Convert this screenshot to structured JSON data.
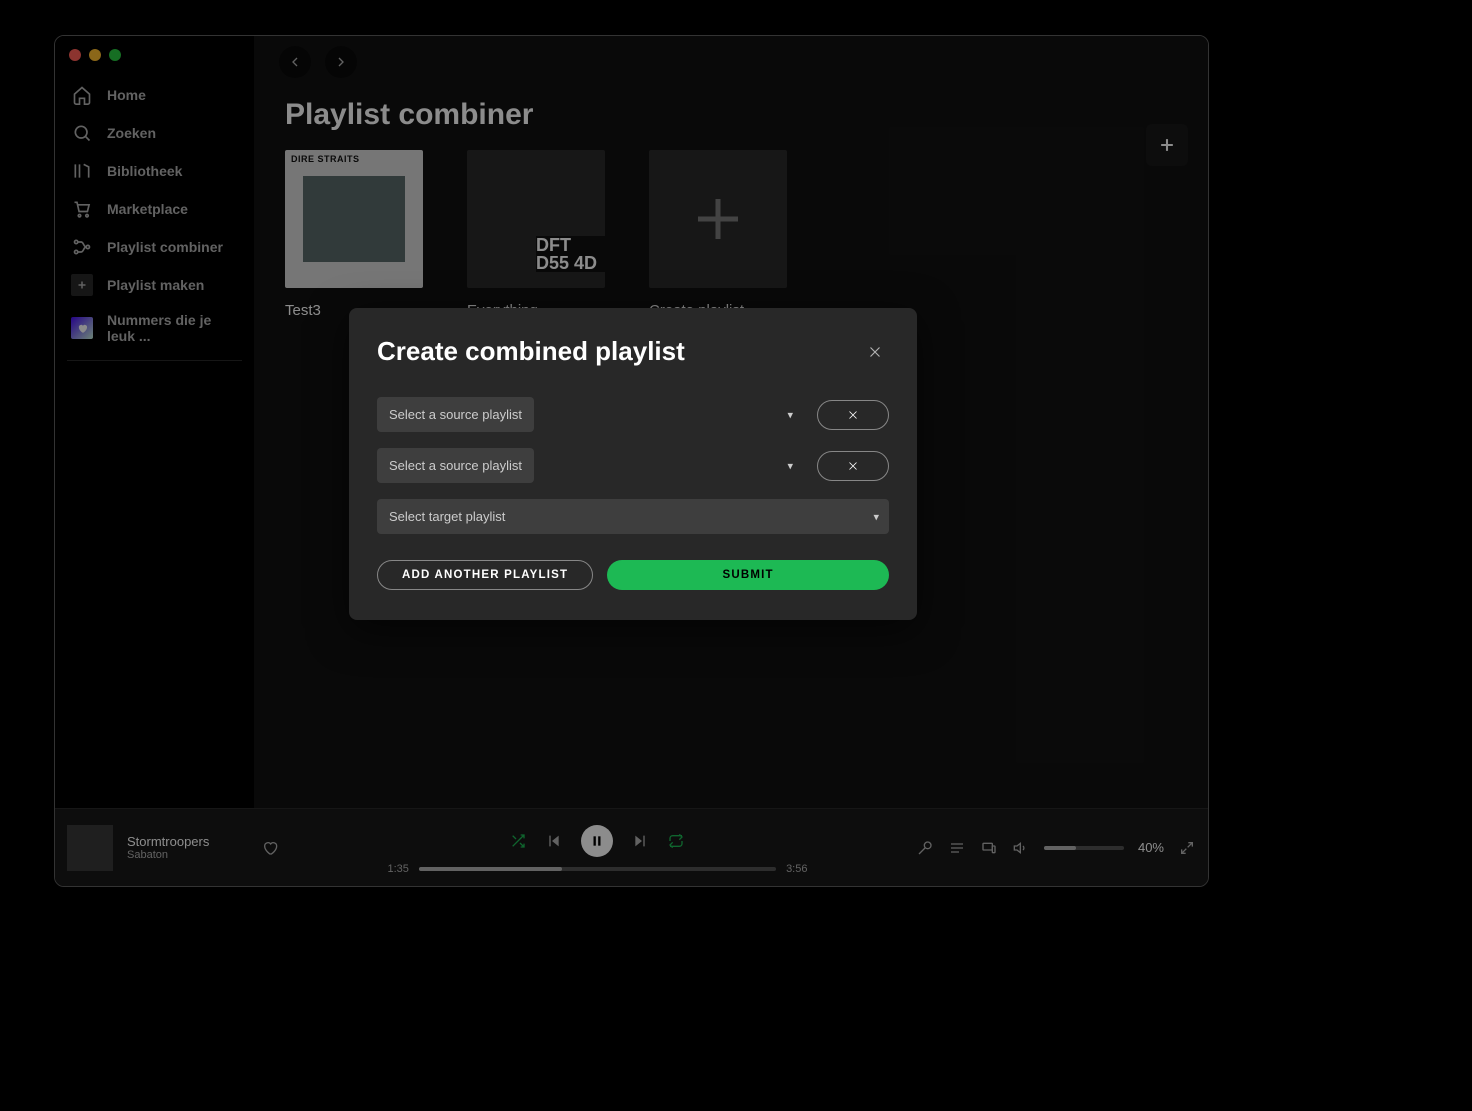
{
  "sidebar": {
    "items": [
      {
        "icon": "home",
        "label": "Home"
      },
      {
        "icon": "search",
        "label": "Zoeken"
      },
      {
        "icon": "library",
        "label": "Bibliotheek"
      },
      {
        "icon": "marketplace",
        "label": "Marketplace"
      },
      {
        "icon": "combiner",
        "label": "Playlist combiner"
      },
      {
        "icon": "plus-square",
        "label": "Playlist maken"
      },
      {
        "icon": "liked",
        "label": "Nummers die je leuk ..."
      }
    ]
  },
  "header": {
    "title": "Playlist combiner"
  },
  "cards": [
    {
      "label": "Test3",
      "kind": "album"
    },
    {
      "label": "Everything",
      "kind": "collage",
      "collage_text": "DFT\nD55\n4D"
    },
    {
      "label": "Create playlist",
      "kind": "create"
    }
  ],
  "modal": {
    "title": "Create combined playlist",
    "source_placeholder": "Select a source playlist",
    "target_placeholder": "Select target playlist",
    "add_button": "ADD ANOTHER PLAYLIST",
    "submit_button": "SUBMIT"
  },
  "player": {
    "track": "Stormtroopers",
    "artist": "Sabaton",
    "elapsed": "1:35",
    "duration": "3:56",
    "progress_pct": 40,
    "volume_label": "40%",
    "volume_pct": 40
  },
  "colors": {
    "accent": "#1db954"
  }
}
